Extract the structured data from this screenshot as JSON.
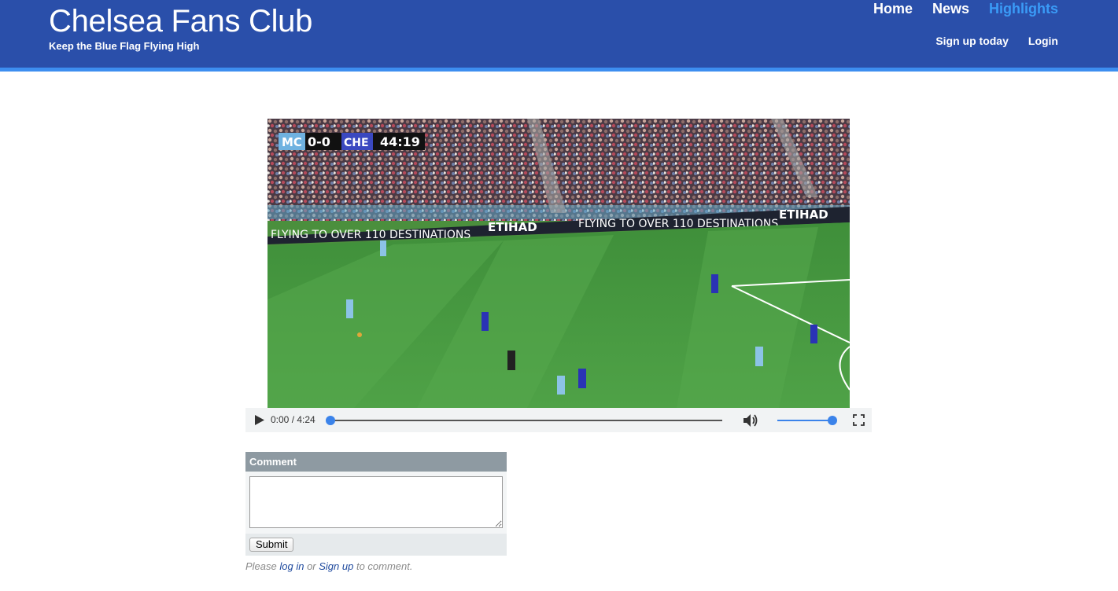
{
  "header": {
    "title": "Chelsea Fans Club",
    "tagline": "Keep the Blue Flag Flying High",
    "nav_primary": [
      {
        "label": "Home",
        "active": false
      },
      {
        "label": "News",
        "active": false
      },
      {
        "label": "Highlights",
        "active": true
      }
    ],
    "nav_secondary": [
      {
        "label": "Sign up today"
      },
      {
        "label": "Login"
      }
    ],
    "colors": {
      "bar": "#2a4faa",
      "stripe": "#3d8ef0",
      "active_link": "#3a9bf7"
    }
  },
  "video": {
    "scoreboard": {
      "home": "MC",
      "score": "0-0",
      "away": "CHE",
      "clock": "44:19"
    },
    "ad_boards": [
      "FLYING TO OVER 110 DESTINATIONS",
      "ETIHAD",
      "FLYING TO OVER 110 DESTINATIONS",
      "ETIHAD"
    ],
    "controls": {
      "play_icon": "play-icon",
      "time": "0:00 / 4:24",
      "progress": 0.0,
      "volume": 1.0,
      "volume_icon": "volume-icon",
      "fullscreen_icon": "fullscreen-icon"
    }
  },
  "comment": {
    "heading": "Comment",
    "textarea_value": "",
    "submit_label": "Submit",
    "note_prefix": "Please ",
    "login_link": "log in",
    "note_or": " or ",
    "signup_link": "Sign up",
    "note_suffix": " to comment."
  }
}
